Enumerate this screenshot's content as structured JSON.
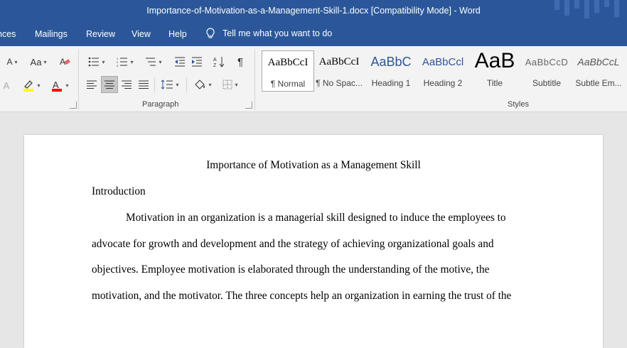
{
  "window": {
    "title": "Importance-of-Motivation-as-a-Management-Skill-1.docx [Compatibility Mode]  -  Word"
  },
  "menu": {
    "tabs": [
      "nces",
      "Mailings",
      "Review",
      "View",
      "Help"
    ],
    "tell_me": "Tell me what you want to do"
  },
  "ribbon": {
    "paragraph_label": "Paragraph",
    "styles_label": "Styles",
    "font": {
      "case_label": "Aa",
      "grow_label": "A",
      "color_label": "A"
    },
    "colors": {
      "highlight": "#ffff00",
      "font_color": "#ff0000",
      "ribbon_bg": "#2b579a"
    },
    "styles": [
      {
        "preview": "AaBbCcI",
        "name": "¶ Normal"
      },
      {
        "preview": "AaBbCcI",
        "name": "¶ No Spac..."
      },
      {
        "preview": "AaBbC",
        "name": "Heading 1"
      },
      {
        "preview": "AaBbCcl",
        "name": "Heading 2"
      },
      {
        "preview": "AaB",
        "name": "Title"
      },
      {
        "preview": "AaBbCcD",
        "name": "Subtitle"
      },
      {
        "preview": "AaBbCcL",
        "name": "Subtle Em..."
      }
    ]
  },
  "document": {
    "title": "Importance of Motivation as a Management Skill",
    "heading": "Introduction",
    "lines": [
      "Motivation in an organization is a managerial skill designed to induce the employees to",
      "advocate for growth and development and the strategy of achieving organizational goals and",
      "objectives. Employee motivation is elaborated through the understanding of the motive, the",
      "motivation, and the motivator. The three concepts help an organization in earning the trust of the"
    ]
  }
}
